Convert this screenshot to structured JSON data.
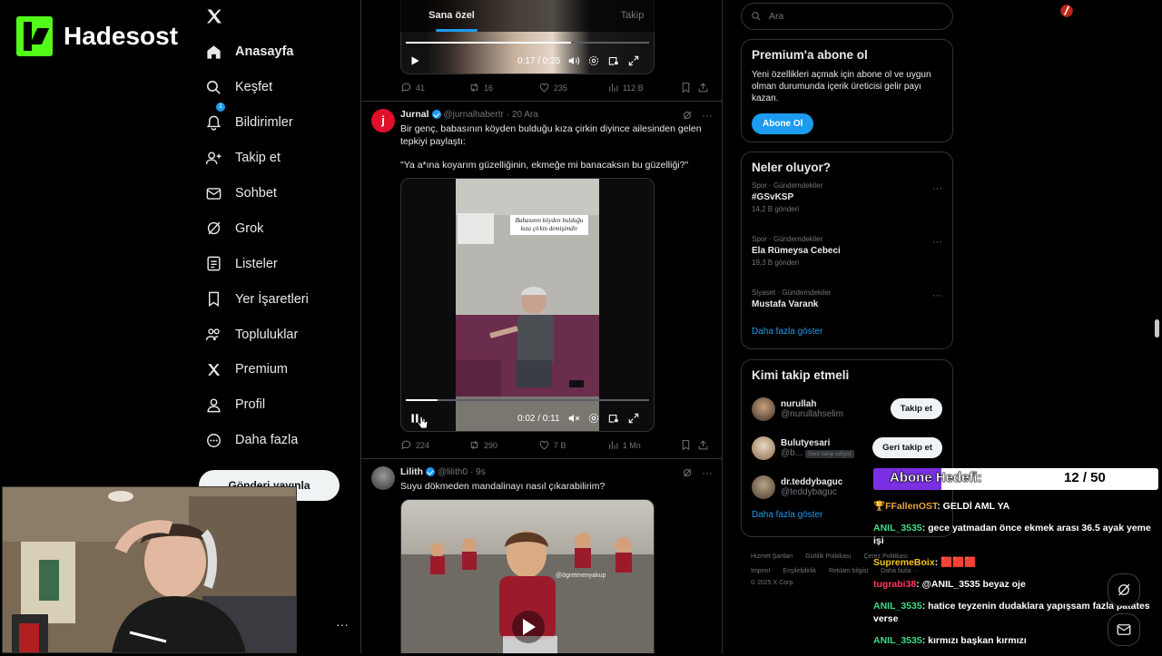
{
  "stream": {
    "channel": "Hadesost"
  },
  "nav": {
    "items": [
      {
        "label": "Anasayfa",
        "icon": "home-icon",
        "active": true
      },
      {
        "label": "Keşfet",
        "icon": "search-icon"
      },
      {
        "label": "Bildirimler",
        "icon": "bell-icon",
        "badge": "1"
      },
      {
        "label": "Takip et",
        "icon": "person-add-icon"
      },
      {
        "label": "Sohbet",
        "icon": "mail-icon"
      },
      {
        "label": "Grok",
        "icon": "grok-icon"
      },
      {
        "label": "Listeler",
        "icon": "list-icon"
      },
      {
        "label": "Yer İşaretleri",
        "icon": "bookmark-icon"
      },
      {
        "label": "Topluluklar",
        "icon": "communities-icon"
      },
      {
        "label": "Premium",
        "icon": "x-icon"
      },
      {
        "label": "Profil",
        "icon": "person-icon"
      },
      {
        "label": "Daha fazla",
        "icon": "more-icon"
      }
    ],
    "post_button": "Gönderi yayınla",
    "more_dots": "···"
  },
  "feed": {
    "tabs": [
      {
        "label": "Sana özel",
        "active": true
      },
      {
        "label": "Takip"
      }
    ],
    "tweet1": {
      "video_time": "0:17 / 0:25",
      "video_progress": 0.68,
      "stats": {
        "replies": "41",
        "retweets": "16",
        "likes": "235",
        "views": "112 B"
      }
    },
    "tweet2": {
      "name": "Jurnal",
      "handle": "@jurnalhabertr",
      "date": "· 20 Ara",
      "avatar_letter": "j",
      "text1": "Bir genç, babasının köyden bulduğu kıza çirkin diyince ailesinden gelen tepkiyi paylaştı:",
      "text2": "\"Ya a*ına koyarım güzelliğinin, ekmeğe mi banacaksın bu güzelliği?\"",
      "video_caption": "Babasının köyden bulduğu kıza çirkin demişimdir",
      "video_time": "0:02 / 0:11",
      "video_progress": 0.13,
      "stats": {
        "replies": "224",
        "retweets": "290",
        "likes": "7 B",
        "views": "1 Mn"
      }
    },
    "tweet3": {
      "name": "Lilith",
      "handle": "@lilith0",
      "date": "· 9s",
      "text": "Suyu dökmeden mandalinayı nasıl çıkarabilirim?",
      "watermark": "@ögretmenyakup"
    }
  },
  "sidebar": {
    "search_placeholder": "Ara",
    "premium": {
      "title": "Premium'a abone ol",
      "text": "Yeni özellikleri açmak için abone ol ve uygun olman durumunda içerik üreticisi gelir payı kazan.",
      "button": "Abone Ol"
    },
    "trends": {
      "title": "Neler oluyor?",
      "items": [
        {
          "meta": "Spor · Gündemdekiler",
          "name": "#GSvKSP",
          "count": "14,2 B gönderi"
        },
        {
          "meta": "Spor · Gündemdekiler",
          "name": "Ela Rümeysa Cebeci",
          "count": "19,3 B gönderi"
        },
        {
          "meta": "Siyaset · Gündemdekiler",
          "name": "Mustafa Varank",
          "count": ""
        }
      ],
      "more": "Daha fazla göster"
    },
    "who_to_follow": {
      "title": "Kimi takip etmeli",
      "items": [
        {
          "name": "nurullah",
          "handle": "@nurullahselim",
          "button": "Takip et"
        },
        {
          "name": "Bulutyesari",
          "handle": "@b...",
          "note": "Seni takip ediyor",
          "button": "Geri takip et"
        },
        {
          "name": "dr.teddybaguc",
          "handle": "@teddybaguc",
          "button": "Takip et"
        }
      ],
      "more": "Daha fazla göster"
    },
    "footer": {
      "links1": [
        "Hizmet Şartları",
        "Gizlilik Politikası",
        "Çerez Politikası"
      ],
      "links2": [
        "Imprint",
        "Erişilebilirlik",
        "Reklam bilgisi",
        "Daha fazla ···"
      ],
      "copyright": "© 2025 X Corp."
    }
  },
  "overlay": {
    "goal_label": "Abone Hedefi:",
    "goal_value": "12 / 50",
    "goal_progress": 0.24,
    "chat": [
      {
        "user": "FFallenOST",
        "user_color": "#e8a33d",
        "text": ": GELDİ AML YA",
        "prefix": "🏆"
      },
      {
        "user": "ANIL_3535",
        "user_color": "#3ddc84",
        "text": ": gece yatmadan önce ekmek arası 36.5 ayak yeme işi"
      },
      {
        "user": "SupremeBoix",
        "user_color": "#f5c518",
        "text": ": 🟥🟥🟥"
      },
      {
        "user": "tugrabi38",
        "user_color": "#ff3b5c",
        "text": ": @ANIL_3535 beyaz oje"
      },
      {
        "user": "ANIL_3535",
        "user_color": "#3ddc84",
        "text": ": hatice teyzenin dudaklara yapışsam fazla patates verse"
      },
      {
        "user": "ANIL_3535",
        "user_color": "#3ddc84",
        "text": ": kırmızı başkan kırmızı"
      }
    ]
  }
}
